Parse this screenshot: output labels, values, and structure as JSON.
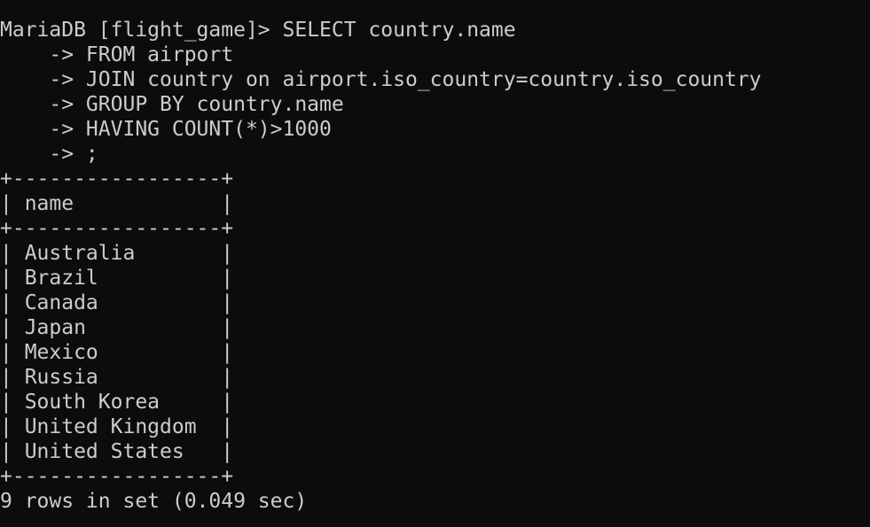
{
  "terminal": {
    "prompt": "MariaDB [flight_game]> ",
    "query_lines": [
      "SELECT country.name",
      "    -> FROM airport",
      "    -> JOIN country on airport.iso_country=country.iso_country",
      "    -> GROUP BY country.name",
      "    -> HAVING COUNT(*)>1000",
      "    -> ;"
    ],
    "result_table": {
      "border_line": "+-----------------+",
      "header_line": "| name            |",
      "rows": [
        "| Australia       |",
        "| Brazil          |",
        "| Canada          |",
        "| Japan           |",
        "| Mexico          |",
        "| Russia          |",
        "| South Korea     |",
        "| United Kingdom  |",
        "| United States   |"
      ]
    },
    "summary": "9 rows in set (0.049 sec)",
    "colors": {
      "background": "#0c0c0c",
      "foreground": "#cccccc"
    }
  }
}
